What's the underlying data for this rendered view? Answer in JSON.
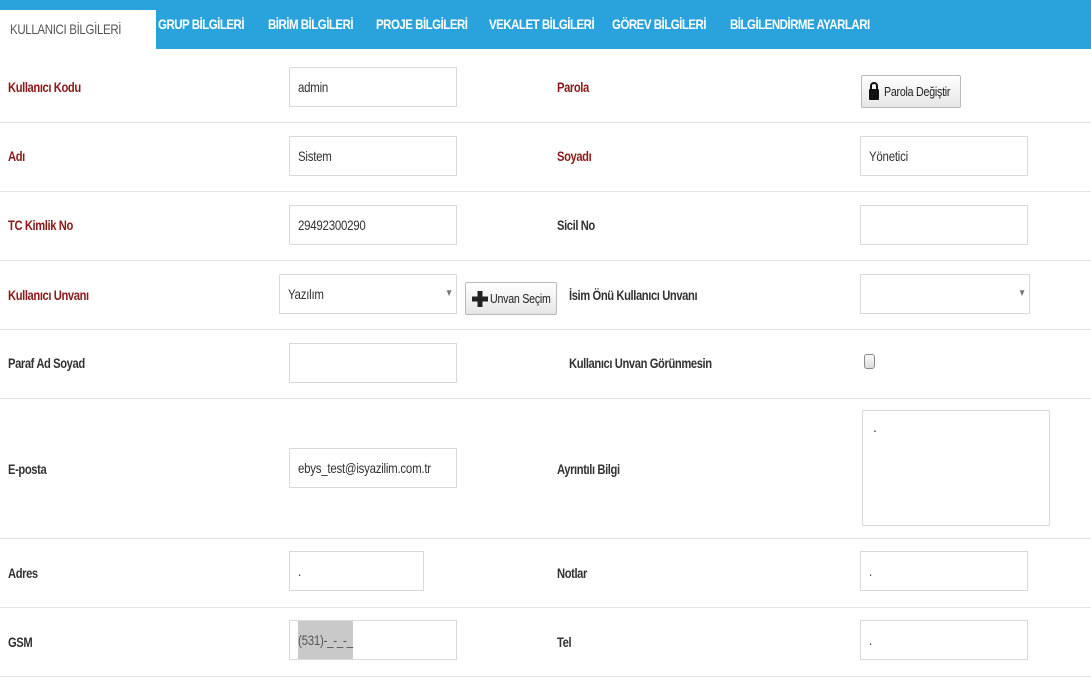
{
  "tabs": [
    {
      "label": "KULLANICI BİLGİLERİ",
      "active": true
    },
    {
      "label": "GRUP BİLGİLERİ",
      "active": false
    },
    {
      "label": "BİRİM BİLGİLERİ",
      "active": false
    },
    {
      "label": "PROJE BİLGİLERİ",
      "active": false
    },
    {
      "label": "VEKALET BİLGİLERİ",
      "active": false
    },
    {
      "label": "GÖREV BİLGİLERİ",
      "active": false
    },
    {
      "label": "BİLGİLENDİRME AYARLARI",
      "active": false
    }
  ],
  "colors": {
    "tab_bar": "#2aa3dd",
    "required_label": "#8b1a1a",
    "normal_label": "#333333"
  },
  "form": {
    "kullanici_kodu": {
      "label": "Kullanıcı Kodu",
      "value": "admin"
    },
    "parola": {
      "label": "Parola",
      "button": "Parola Değiştir",
      "button_icon": "lock-icon"
    },
    "adi": {
      "label": "Adı",
      "value": "Sistem"
    },
    "soyadi": {
      "label": "Soyadı",
      "value": "Yönetici"
    },
    "tc_kimlik_no": {
      "label": "TC Kimlik No",
      "value": "29492300290"
    },
    "sicil_no": {
      "label": "Sicil No",
      "value": ""
    },
    "kullanici_unvani": {
      "label": "Kullanıcı Unvanı",
      "value": "Yazılım",
      "button": "Unvan Seçim",
      "button_icon": "plus-icon"
    },
    "isim_onu_unvani": {
      "label": "İsim Önü Kullanıcı Unvanı",
      "value": ""
    },
    "paraf_ad_soyad": {
      "label": "Paraf Ad Soyad",
      "value": ""
    },
    "unvan_gorunmesin": {
      "label": "Kullanıcı Unvan Görünmesin",
      "checked": false
    },
    "eposta": {
      "label": "E-posta",
      "value": "ebys_test@isyazilim.com.tr"
    },
    "ayrintili_bilgi": {
      "label": "Ayrıntılı Bilgi",
      "value": "."
    },
    "adres": {
      "label": "Adres",
      "value": "."
    },
    "notlar": {
      "label": "Notlar",
      "value": "."
    },
    "gsm": {
      "label": "GSM",
      "value": "(531)-_-_-_"
    },
    "tel": {
      "label": "Tel",
      "value": "."
    }
  }
}
